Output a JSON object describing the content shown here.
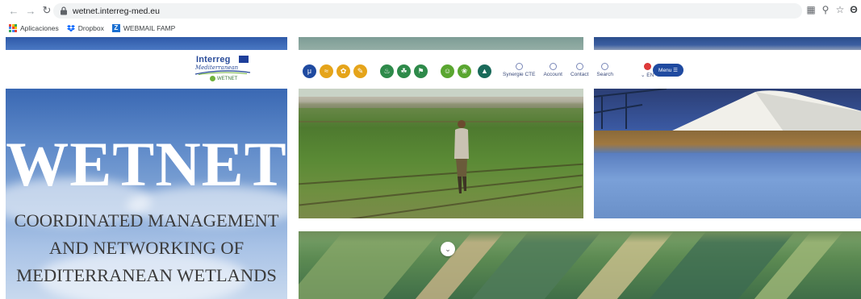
{
  "browser": {
    "url": "wetnet.interreg-med.eu",
    "bookmarks": [
      {
        "label": "Aplicaciones",
        "icon": "apps-grid-icon"
      },
      {
        "label": "Dropbox",
        "icon": "dropbox-icon"
      },
      {
        "label": "WEBMAIL FAMP",
        "icon": "webmail-icon"
      }
    ]
  },
  "site": {
    "logo": {
      "title": "Interreg",
      "subtitle": "Mediterranean",
      "tag": "WETNET"
    },
    "axis_icons": [
      {
        "name": "m-icon",
        "color": "#1f4aa0"
      },
      {
        "name": "axis-1-icon",
        "color": "#e5a41a"
      },
      {
        "name": "axis-2-icon",
        "color": "#e5a41a"
      },
      {
        "name": "axis-3-icon",
        "color": "#e5a41a"
      },
      {
        "name": "axis-4-icon",
        "color": "#2e8a4a"
      },
      {
        "name": "axis-5-icon",
        "color": "#2e8a4a"
      },
      {
        "name": "axis-6-icon",
        "color": "#2e8a4a"
      },
      {
        "name": "axis-7-icon",
        "color": "#5aa630"
      },
      {
        "name": "axis-8-icon",
        "color": "#5aa630"
      },
      {
        "name": "axis-9-icon",
        "color": "#1a6a5a"
      }
    ],
    "util_links": [
      {
        "label": "Synergie CTE",
        "icon": "synergie-icon"
      },
      {
        "label": "Account",
        "icon": "account-icon"
      },
      {
        "label": "Contact",
        "icon": "contact-icon"
      },
      {
        "label": "Search",
        "icon": "search-icon"
      },
      {
        "label": "EN",
        "icon": "language-flag-icon"
      }
    ],
    "menu_label": "Menu ☰"
  },
  "hero": {
    "title": "WETNET",
    "subtitle_lines": [
      "COORDINATED MANAGEMENT",
      "AND NETWORKING  OF",
      "MEDITERRANEAN WETLANDS"
    ]
  },
  "colors": {
    "brand_blue": "#1f4aa0",
    "hero_sky": "#86a9d8"
  }
}
